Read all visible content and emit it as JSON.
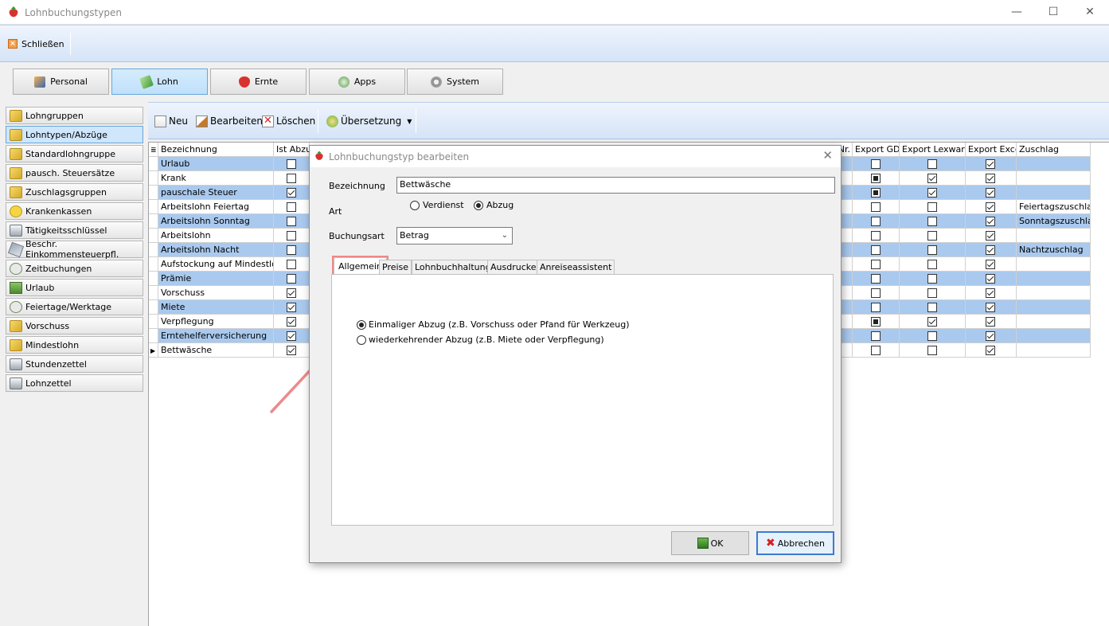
{
  "window": {
    "title": "Lohnbuchungstypen",
    "controls": [
      "—",
      "☐",
      "✕"
    ]
  },
  "ribbon": {
    "close_label": "Schließen"
  },
  "modules": [
    {
      "label": "Personal",
      "icon": "people-icon"
    },
    {
      "label": "Lohn",
      "icon": "money-icon",
      "active": true
    },
    {
      "label": "Ernte",
      "icon": "strawberry-icon"
    },
    {
      "label": "Apps",
      "icon": "apps-icon"
    },
    {
      "label": "System",
      "icon": "gear-icon"
    }
  ],
  "sidebar": [
    {
      "label": "Lohngruppen",
      "icon": "folder-icon"
    },
    {
      "label": "Lohntypen/Abzüge",
      "icon": "folder-icon",
      "active": true
    },
    {
      "label": "Standardlohngruppe",
      "icon": "folder-icon"
    },
    {
      "label": "pausch. Steuersätze",
      "icon": "folder-icon"
    },
    {
      "label": "Zuschlagsgruppen",
      "icon": "folder-icon"
    },
    {
      "label": "Krankenkassen",
      "icon": "smiley-icon"
    },
    {
      "label": "Tätigkeitsschlüssel",
      "icon": "printer-icon"
    },
    {
      "label": "Beschr. Einkommensteuerpfl.",
      "icon": "tools-icon"
    },
    {
      "label": "Zeitbuchungen",
      "icon": "clock-icon"
    },
    {
      "label": "Urlaub",
      "icon": "table-icon"
    },
    {
      "label": "Feiertage/Werktage",
      "icon": "clock-icon"
    },
    {
      "label": "Vorschuss",
      "icon": "folder-icon"
    },
    {
      "label": "Mindestlohn",
      "icon": "folder-icon"
    },
    {
      "label": "Stundenzettel",
      "icon": "printer-icon"
    },
    {
      "label": "Lohnzettel",
      "icon": "printer-icon"
    }
  ],
  "toolbar": {
    "new_label": "Neu",
    "edit_label": "Bearbeiten",
    "delete_label": "Löschen",
    "translate_label": "Übersetzung"
  },
  "grid": {
    "headers": {
      "name": "Bezeichnung",
      "abzug": "Ist Abzug",
      "nr": "Nr.",
      "gdi": "Export GDI",
      "lexware": "Export Lexware",
      "excel": "Export Excel",
      "zuschlag": "Zuschlag"
    },
    "rows": [
      {
        "name": "Urlaub",
        "abzug": false,
        "gdi": "empty",
        "lex": false,
        "excel": true,
        "zuschlag": ""
      },
      {
        "name": "Krank",
        "abzug": false,
        "gdi": "filled",
        "lex": true,
        "excel": true,
        "zuschlag": ""
      },
      {
        "name": "pauschale Steuer",
        "abzug": true,
        "gdi": "filled",
        "lex": true,
        "excel": true,
        "zuschlag": ""
      },
      {
        "name": "Arbeitslohn Feiertag",
        "abzug": false,
        "gdi": "empty",
        "lex": false,
        "excel": true,
        "zuschlag": "Feiertagszuschlag"
      },
      {
        "name": "Arbeitslohn Sonntag",
        "abzug": false,
        "gdi": "empty",
        "lex": false,
        "excel": true,
        "zuschlag": "Sonntagszuschlag"
      },
      {
        "name": "Arbeitslohn",
        "abzug": false,
        "gdi": "empty",
        "lex": false,
        "excel": true,
        "zuschlag": ""
      },
      {
        "name": "Arbeitslohn Nacht",
        "abzug": false,
        "gdi": "empty",
        "lex": false,
        "excel": true,
        "zuschlag": "Nachtzuschlag"
      },
      {
        "name": "Aufstockung auf Mindestlohn",
        "abzug": false,
        "gdi": "empty",
        "lex": false,
        "excel": true,
        "zuschlag": ""
      },
      {
        "name": "Prämie",
        "abzug": false,
        "gdi": "empty",
        "lex": false,
        "excel": true,
        "zuschlag": ""
      },
      {
        "name": "Vorschuss",
        "abzug": true,
        "gdi": "empty",
        "lex": false,
        "excel": true,
        "zuschlag": ""
      },
      {
        "name": "Miete",
        "abzug": true,
        "gdi": "empty",
        "lex": false,
        "excel": true,
        "zuschlag": ""
      },
      {
        "name": "Verpflegung",
        "abzug": true,
        "gdi": "filled",
        "lex": true,
        "excel": true,
        "zuschlag": ""
      },
      {
        "name": "Erntehelferversicherung",
        "abzug": true,
        "gdi": "empty",
        "lex": false,
        "excel": true,
        "zuschlag": ""
      },
      {
        "name": "Bettwäsche",
        "abzug": true,
        "gdi": "empty",
        "lex": false,
        "excel": true,
        "zuschlag": "",
        "current": true
      }
    ]
  },
  "dialog": {
    "title": "Lohnbuchungstyp bearbeiten",
    "bezeichnung_label": "Bezeichnung",
    "bezeichnung_value": "Bettwäsche",
    "art_label": "Art",
    "art_verdienst": "Verdienst",
    "art_abzug": "Abzug",
    "buchungsart_label": "Buchungsart",
    "buchungsart_value": "Betrag",
    "tabs": [
      "Allgemein",
      "Preise",
      "Lohnbuchhaltung",
      "Ausdrucke",
      "Anreiseassistent"
    ],
    "option_once": "Einmaliger Abzug (z.B. Vorschuss oder Pfand für Werkzeug)",
    "option_recurring": "wiederkehrender Abzug (z.B. Miete oder Verpflegung)",
    "ok_label": "OK",
    "cancel_label": "Abbrechen"
  },
  "colors": {
    "accent_blue": "#a9c9ee",
    "highlight": "#ec8a8a",
    "annotation_arrow": "#ec8a8a"
  }
}
